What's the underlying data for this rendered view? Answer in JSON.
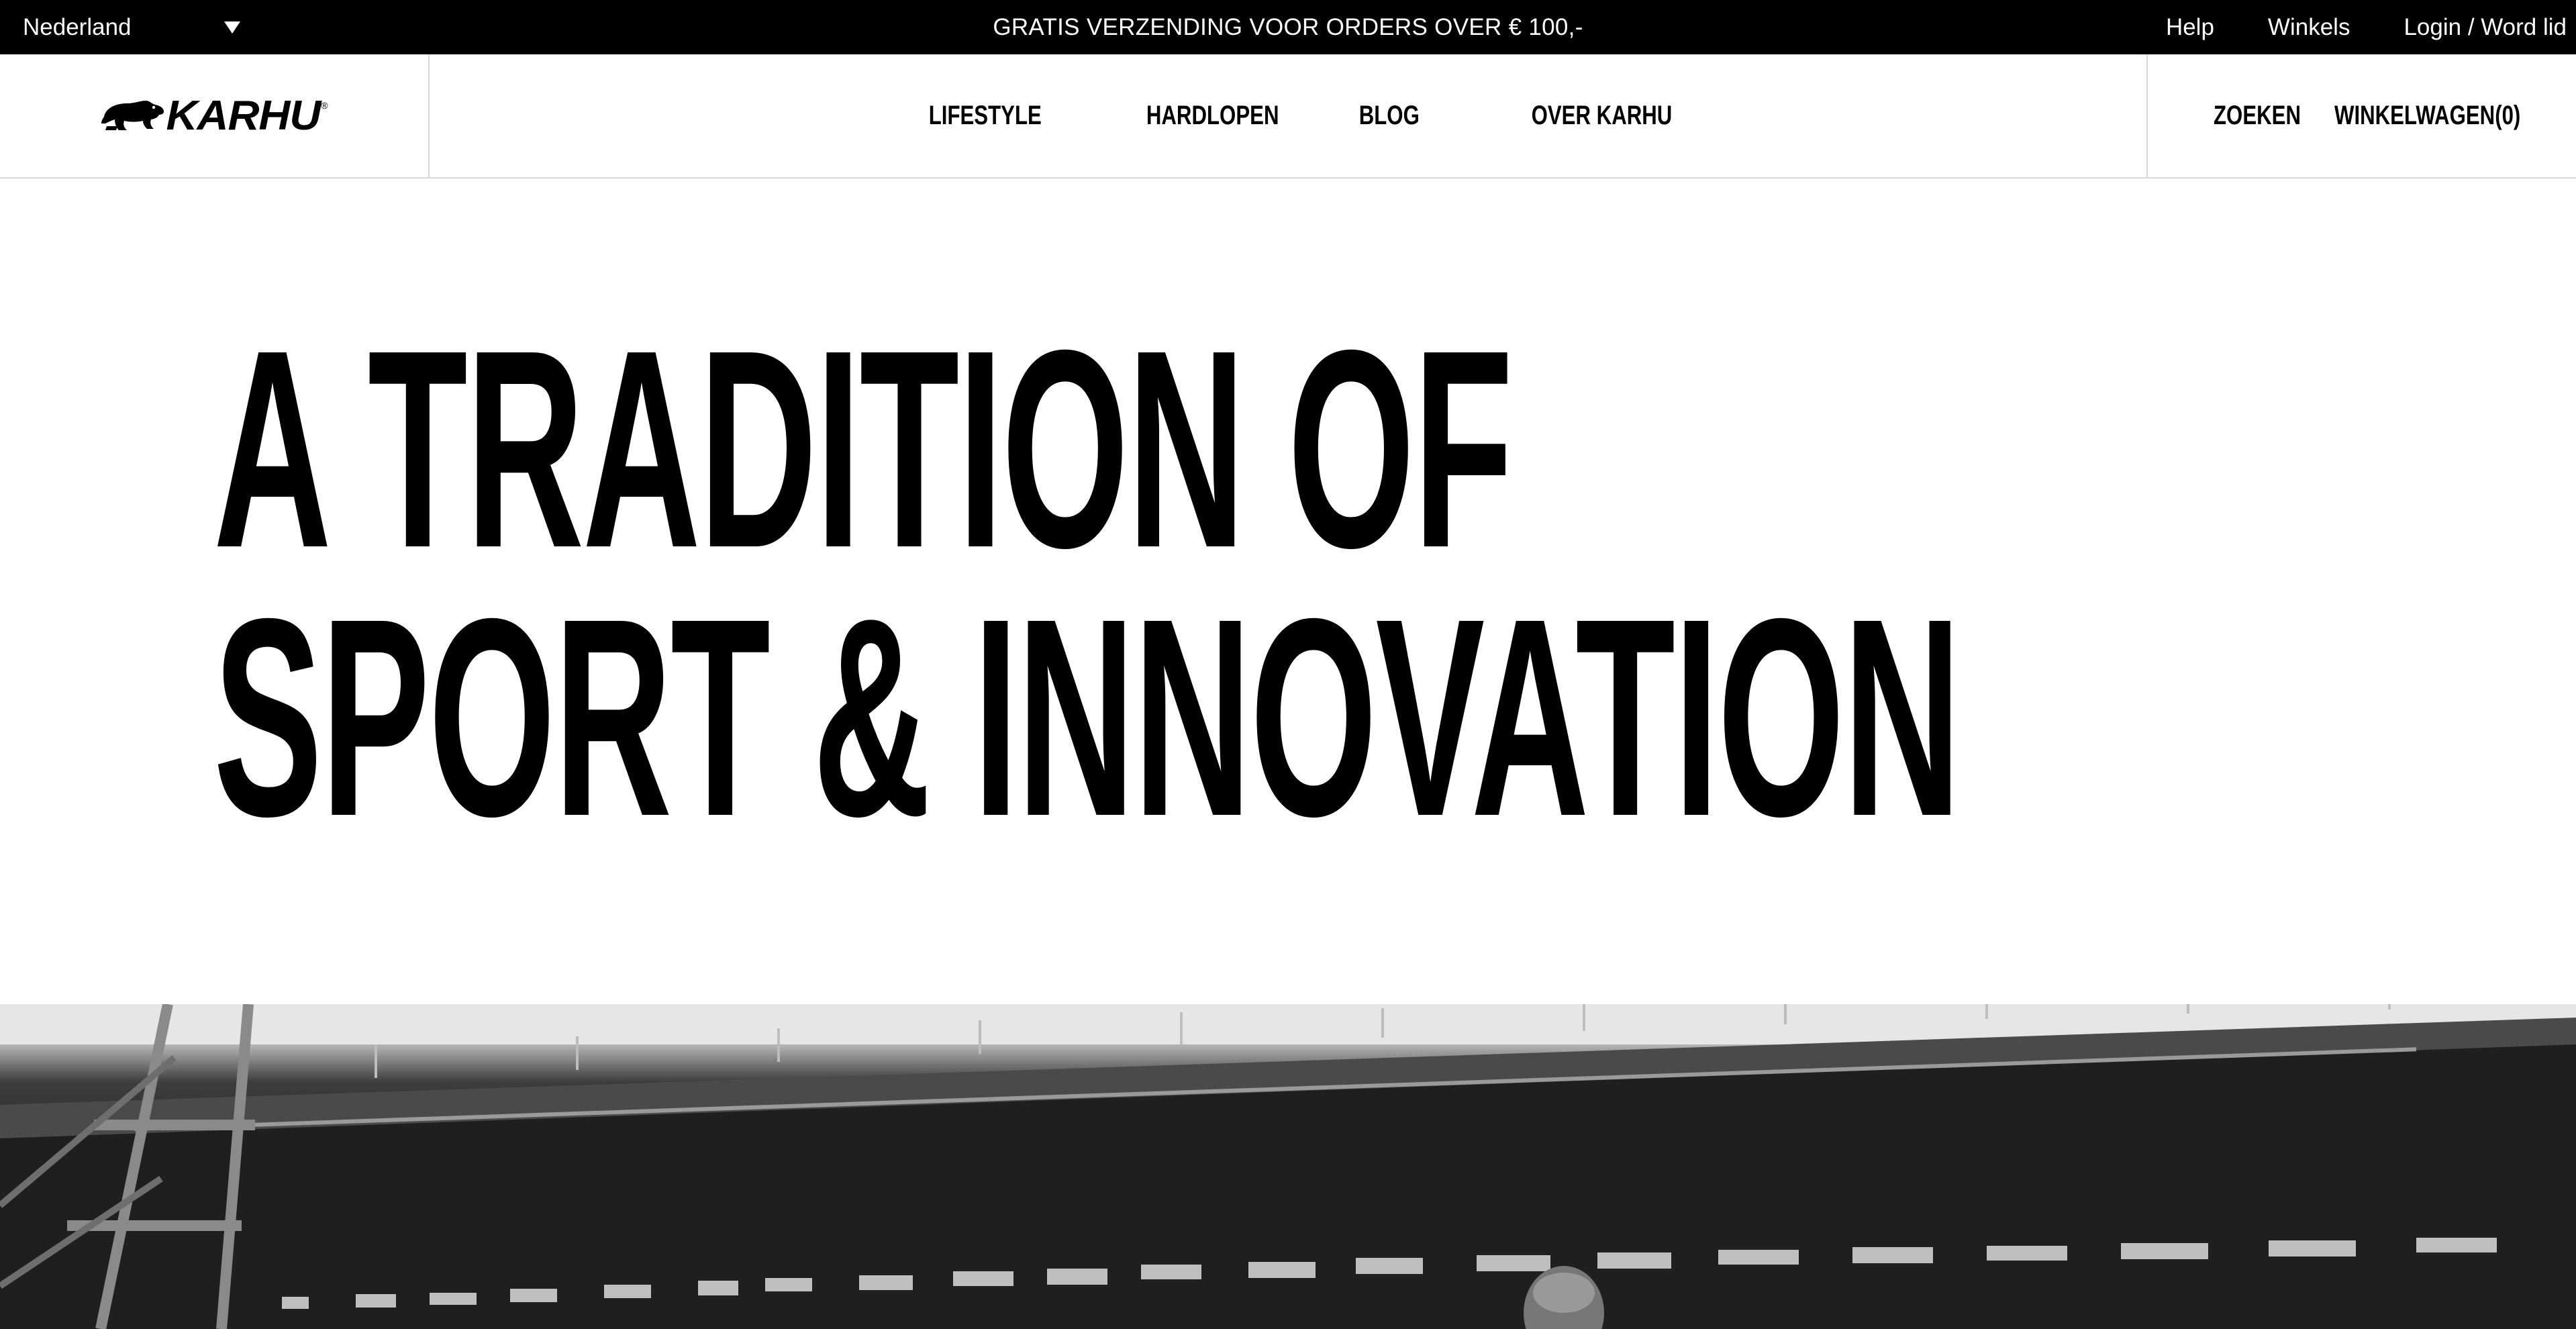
{
  "topbar": {
    "country": "Nederland",
    "promo": "GRATIS VERZENDING VOOR ORDERS OVER € 100,-",
    "links": [
      "Help",
      "Winkels",
      "Login / Word lid"
    ]
  },
  "header": {
    "logo": "KARHU",
    "logo_mark": "®",
    "nav": [
      "LIFESTYLE",
      "HARDLOPEN",
      "BLOG",
      "OVER KARHU"
    ],
    "search": "ZOEKEN",
    "cart": "WINKELWAGEN(0)"
  },
  "hero": {
    "line1": "A TRADITION OF",
    "line2": "SPORT & INNOVATION"
  },
  "colors": {
    "background": "#ffffff",
    "text": "#000000",
    "topbar": "#000000",
    "divider": "#d9d9d9"
  },
  "icons": [
    "chevron-down-icon",
    "bear-icon"
  ]
}
